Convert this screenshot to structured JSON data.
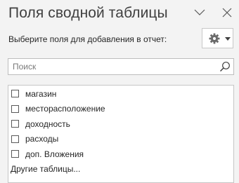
{
  "pane": {
    "title": "Поля сводной таблицы",
    "choose_label": "Выберите поля для добавления в отчет:",
    "header_icons": [
      "chevron-down-icon",
      "close-icon"
    ],
    "tools_icons": [
      "gear-icon",
      "caret-down-icon"
    ]
  },
  "search": {
    "placeholder": "Поиск",
    "value": "",
    "icon": "magnifier-icon"
  },
  "fields": [
    {
      "label": "магазин",
      "checked": false
    },
    {
      "label": "месторасположение",
      "checked": false
    },
    {
      "label": "доходность",
      "checked": false
    },
    {
      "label": "расходы",
      "checked": false
    },
    {
      "label": "доп. Вложения",
      "checked": false
    }
  ],
  "more_tables": "Другие таблицы..."
}
